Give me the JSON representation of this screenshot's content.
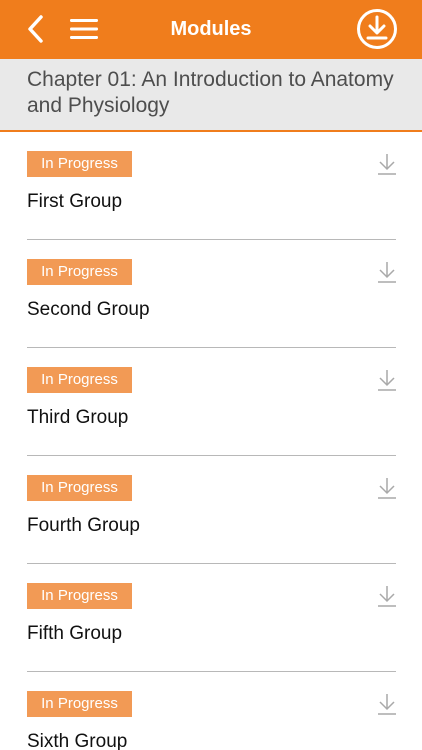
{
  "navbar": {
    "title": "Modules",
    "icons": {
      "back": "chevron-left-icon",
      "menu": "hamburger-menu-icon",
      "download_all": "download-circle-icon"
    },
    "colors": {
      "accent": "#f07d1c",
      "badge": "#f29a55"
    }
  },
  "chapter": {
    "title": "Chapter 01: An Introduction to Anatomy and Physiology"
  },
  "modules": [
    {
      "status": "In Progress",
      "name": "First Group"
    },
    {
      "status": "In Progress",
      "name": "Second Group"
    },
    {
      "status": "In Progress",
      "name": "Third Group"
    },
    {
      "status": "In Progress",
      "name": "Fourth Group"
    },
    {
      "status": "In Progress",
      "name": "Fifth Group"
    },
    {
      "status": "In Progress",
      "name": "Sixth Group"
    }
  ]
}
